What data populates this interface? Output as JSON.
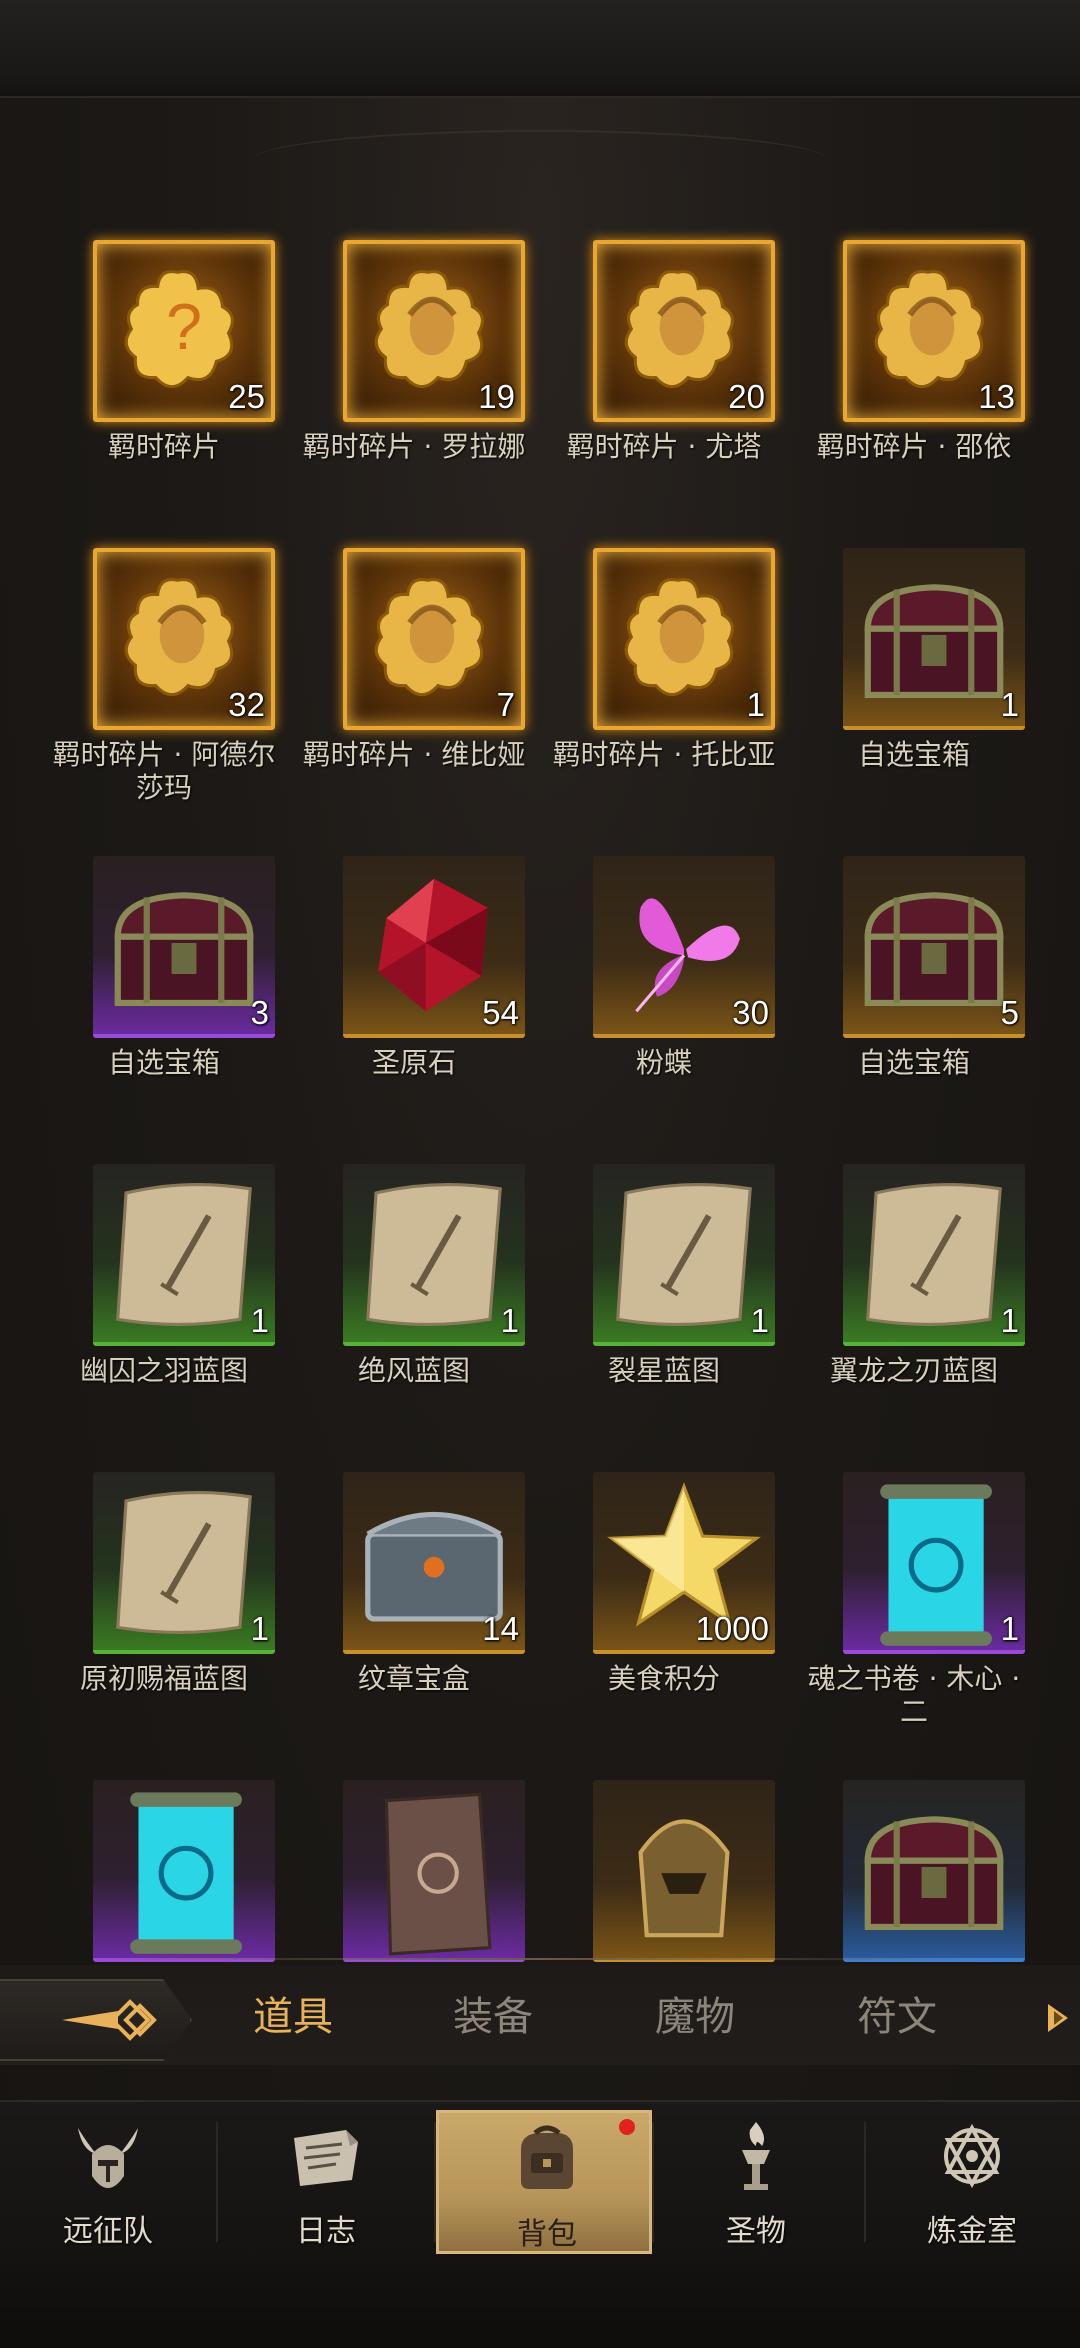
{
  "items": [
    {
      "name": "羁时碎片",
      "count": "25",
      "rarity": "orange",
      "icon": "puzzle-question-icon"
    },
    {
      "name": "羁时碎片 · 罗拉娜",
      "count": "19",
      "rarity": "orange",
      "icon": "puzzle-portrait-icon"
    },
    {
      "name": "羁时碎片 · 尤塔",
      "count": "20",
      "rarity": "orange",
      "icon": "puzzle-portrait-icon"
    },
    {
      "name": "羁时碎片 · 邵依",
      "count": "13",
      "rarity": "orange",
      "icon": "puzzle-portrait-icon"
    },
    {
      "name": "羁时碎片 · 阿德尔莎玛",
      "count": "32",
      "rarity": "orange",
      "icon": "puzzle-portrait-icon"
    },
    {
      "name": "羁时碎片 · 维比娅",
      "count": "7",
      "rarity": "orange",
      "icon": "puzzle-portrait-icon"
    },
    {
      "name": "羁时碎片 · 托比亚",
      "count": "1",
      "rarity": "orange",
      "icon": "puzzle-portrait-icon"
    },
    {
      "name": "自选宝箱",
      "count": "1",
      "rarity": "gold",
      "icon": "treasure-chest-icon"
    },
    {
      "name": "自选宝箱",
      "count": "3",
      "rarity": "purple",
      "icon": "treasure-chest-icon"
    },
    {
      "name": "圣原石",
      "count": "54",
      "rarity": "gold",
      "icon": "ruby-gem-icon"
    },
    {
      "name": "粉蝶",
      "count": "30",
      "rarity": "gold",
      "icon": "pink-butterfly-icon"
    },
    {
      "name": "自选宝箱",
      "count": "5",
      "rarity": "gold",
      "icon": "treasure-chest-icon"
    },
    {
      "name": "幽囚之羽蓝图",
      "count": "1",
      "rarity": "green",
      "icon": "blueprint-scroll-icon"
    },
    {
      "name": "绝风蓝图",
      "count": "1",
      "rarity": "green",
      "icon": "blueprint-scroll-icon"
    },
    {
      "name": "裂星蓝图",
      "count": "1",
      "rarity": "green",
      "icon": "blueprint-scroll-icon"
    },
    {
      "name": "翼龙之刃蓝图",
      "count": "1",
      "rarity": "green",
      "icon": "blueprint-scroll-icon"
    },
    {
      "name": "原初赐福蓝图",
      "count": "1",
      "rarity": "green",
      "icon": "blueprint-scroll-icon"
    },
    {
      "name": "纹章宝盒",
      "count": "14",
      "rarity": "gold",
      "icon": "silver-casket-icon"
    },
    {
      "name": "美食积分",
      "count": "1000",
      "rarity": "gold",
      "icon": "gold-star-icon"
    },
    {
      "name": "魂之书卷 · 木心 · 二",
      "count": "1",
      "rarity": "purple",
      "icon": "glowing-scroll-icon"
    },
    {
      "name": "",
      "count": "",
      "rarity": "purple",
      "icon": "glowing-scroll-icon"
    },
    {
      "name": "",
      "count": "",
      "rarity": "purple",
      "icon": "old-parchment-icon"
    },
    {
      "name": "",
      "count": "",
      "rarity": "gold",
      "icon": "bronze-helmet-icon"
    },
    {
      "name": "",
      "count": "",
      "rarity": "blue",
      "icon": "treasure-chest-icon"
    }
  ],
  "tabs": [
    {
      "label": "道具",
      "active": true
    },
    {
      "label": "装备",
      "active": false
    },
    {
      "label": "魔物",
      "active": false
    },
    {
      "label": "符文",
      "active": false
    }
  ],
  "nav": [
    {
      "label": "远征队",
      "icon": "horned-helmet-icon",
      "active": false
    },
    {
      "label": "日志",
      "icon": "map-scroll-icon",
      "active": false
    },
    {
      "label": "背包",
      "icon": "backpack-icon",
      "active": true,
      "badge": true
    },
    {
      "label": "圣物",
      "icon": "torch-icon",
      "active": false
    },
    {
      "label": "炼金室",
      "icon": "alchemy-icon",
      "active": false
    }
  ],
  "colors": {
    "accent": "#e8b25a",
    "orange_frame": "#e9a732",
    "badge": "#e0211d"
  }
}
